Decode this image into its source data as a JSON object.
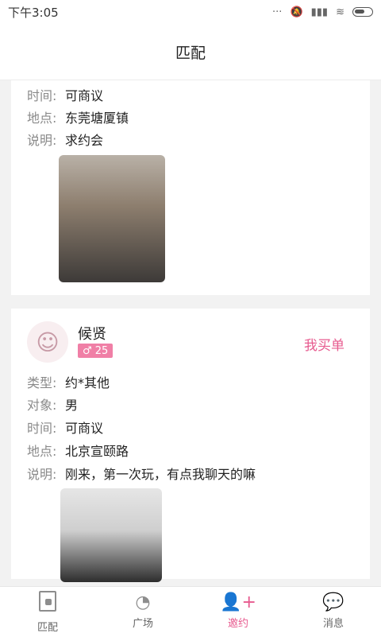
{
  "status": {
    "time": "下午3:05"
  },
  "header": {
    "title": "匹配"
  },
  "cards": [
    {
      "rows": [
        {
          "k": "时间:",
          "v": "可商议"
        },
        {
          "k": "地点:",
          "v": "东莞塘厦镇"
        },
        {
          "k": "说明:",
          "v": "求约会"
        }
      ]
    },
    {
      "user": {
        "name": "候贤",
        "gender_age": "♂ 25"
      },
      "action": "我买单",
      "rows": [
        {
          "k": "类型:",
          "v": "约*其他"
        },
        {
          "k": "对象:",
          "v": "男"
        },
        {
          "k": "时间:",
          "v": "可商议"
        },
        {
          "k": "地点:",
          "v": "北京宣颐路"
        },
        {
          "k": "说明:",
          "v": "刚来，第一次玩，有点我聊天的嘛"
        }
      ]
    }
  ],
  "tabs": [
    {
      "label": "匹配",
      "icon": "match-icon"
    },
    {
      "label": "广场",
      "icon": "chat-bubble-icon"
    },
    {
      "label": "邀约",
      "icon": "add-user-icon"
    },
    {
      "label": "消息",
      "icon": "message-icon"
    }
  ],
  "colors": {
    "accent": "#e75b8f",
    "badge": "#f07fa6"
  }
}
